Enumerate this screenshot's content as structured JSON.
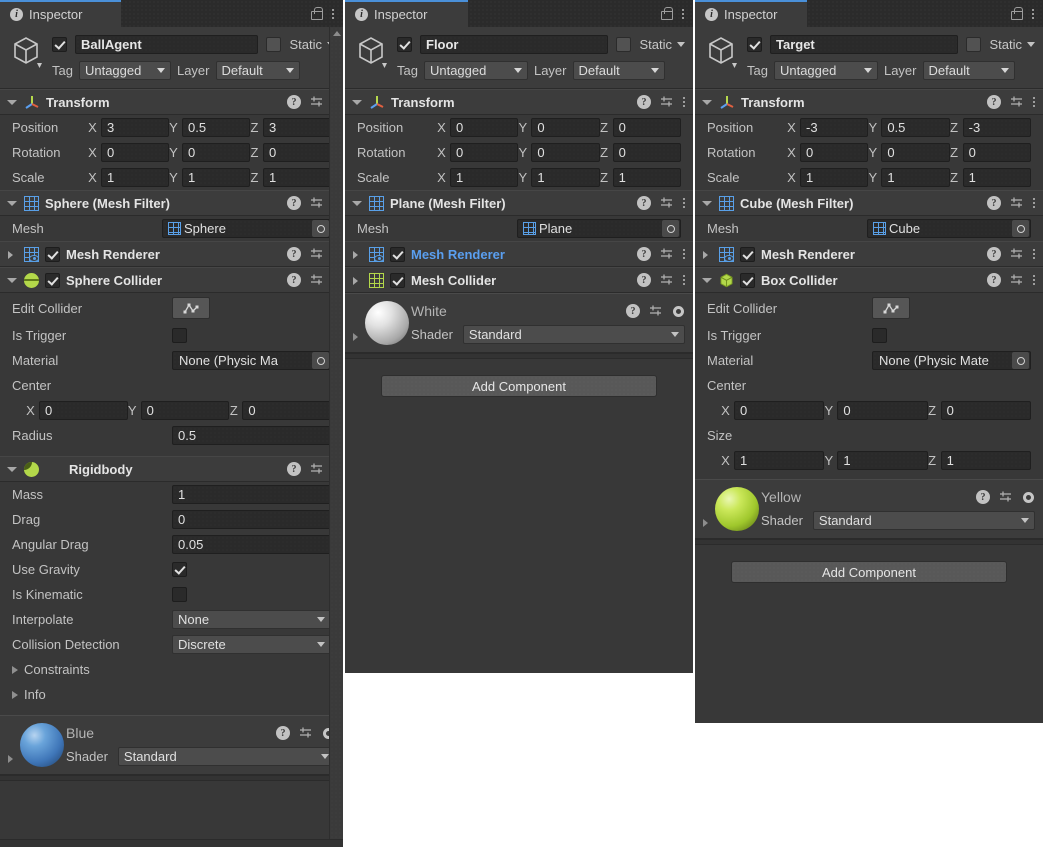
{
  "tab": {
    "label": "Inspector",
    "info_icon": "info-icon",
    "lock_icon": "lock-icon",
    "menu_icon": "kebab-menu-icon"
  },
  "common": {
    "static_label": "Static",
    "tag_label": "Tag",
    "layer_label": "Layer",
    "tag_value": "Untagged",
    "layer_value": "Default",
    "transform_title": "Transform",
    "position_label": "Position",
    "rotation_label": "Rotation",
    "scale_label": "Scale",
    "axis_x": "X",
    "axis_y": "Y",
    "axis_z": "Z",
    "mesh_label": "Mesh",
    "mesh_renderer_title": "Mesh Renderer",
    "edit_collider_label": "Edit Collider",
    "is_trigger_label": "Is Trigger",
    "material_label": "Material",
    "center_label": "Center",
    "size_label": "Size",
    "shader_label": "Shader",
    "shader_value": "Standard",
    "add_component_label": "Add Component",
    "physic_material_none": "None (Physic Ma",
    "physic_material_none_wide": "None (Physic Mate",
    "help_icon": "help-icon",
    "preset_icon": "preset-icon",
    "gear_icon": "gear-icon",
    "component_menu_icon": "kebab-menu-icon"
  },
  "colors": {
    "panel_bg": "#383838",
    "header_bg": "#3c3c3c",
    "field_bg": "#2a2a2a",
    "accent_blue": "#4a90d9",
    "link_blue": "#5a9ff0",
    "green_icon": "#b3d84a",
    "grid_blue": "#59a0e8"
  },
  "panels": [
    {
      "id": "ball",
      "name": "BallAgent",
      "transform": {
        "position": {
          "x": "3",
          "y": "0.5",
          "z": "3"
        },
        "rotation": {
          "x": "0",
          "y": "0",
          "z": "0"
        },
        "scale": {
          "x": "1",
          "y": "1",
          "z": "1"
        }
      },
      "mesh_filter_title": "Sphere (Mesh Filter)",
      "mesh_value": "Sphere",
      "collider": {
        "title": "Sphere Collider",
        "center": {
          "x": "0",
          "y": "0",
          "z": "0"
        },
        "radius_label": "Radius",
        "radius": "0.5",
        "material": "None (Physic Ma"
      },
      "rigidbody": {
        "title": "Rigidbody",
        "mass_label": "Mass",
        "mass": "1",
        "drag_label": "Drag",
        "drag": "0",
        "angular_drag_label": "Angular Drag",
        "angular_drag": "0.05",
        "use_gravity_label": "Use Gravity",
        "use_gravity": true,
        "is_kinematic_label": "Is Kinematic",
        "is_kinematic": false,
        "interpolate_label": "Interpolate",
        "interpolate": "None",
        "collision_detection_label": "Collision Detection",
        "collision_detection": "Discrete",
        "constraints_label": "Constraints",
        "info_label": "Info"
      },
      "material": {
        "name": "Blue",
        "shader": "Standard",
        "swatch": "#4a86c8"
      }
    },
    {
      "id": "floor",
      "name": "Floor",
      "transform": {
        "position": {
          "x": "0",
          "y": "0",
          "z": "0"
        },
        "rotation": {
          "x": "0",
          "y": "0",
          "z": "0"
        },
        "scale": {
          "x": "1",
          "y": "1",
          "z": "1"
        }
      },
      "mesh_filter_title": "Plane (Mesh Filter)",
      "mesh_value": "Plane",
      "mesh_collider_title": "Mesh Collider",
      "material": {
        "name": "White",
        "shader": "Standard",
        "swatch": "#d8d8d8"
      }
    },
    {
      "id": "target",
      "name": "Target",
      "transform": {
        "position": {
          "x": "-3",
          "y": "0.5",
          "z": "-3"
        },
        "rotation": {
          "x": "0",
          "y": "0",
          "z": "0"
        },
        "scale": {
          "x": "1",
          "y": "1",
          "z": "1"
        }
      },
      "mesh_filter_title": "Cube (Mesh Filter)",
      "mesh_value": "Cube",
      "collider": {
        "title": "Box Collider",
        "center": {
          "x": "0",
          "y": "0",
          "z": "0"
        },
        "size": {
          "x": "1",
          "y": "1",
          "z": "1"
        },
        "material": "None (Physic Mate"
      },
      "material": {
        "name": "Yellow",
        "shader": "Standard",
        "swatch": "#b9dc3c"
      }
    }
  ]
}
